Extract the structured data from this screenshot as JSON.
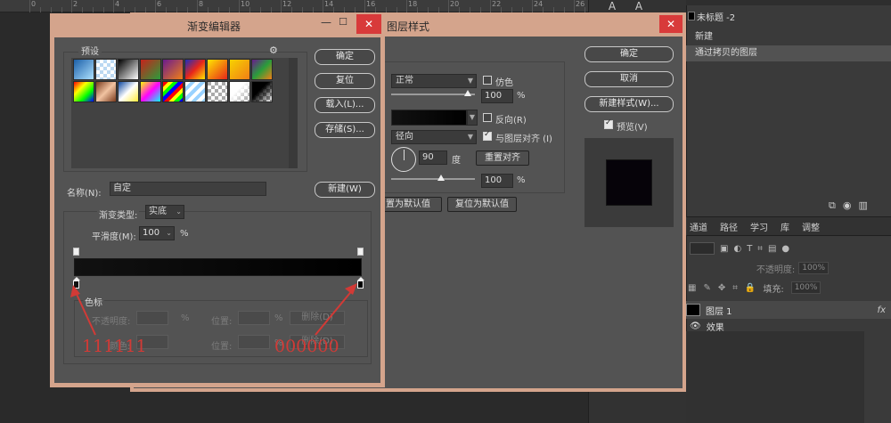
{
  "background_app": {
    "ruler_numbers": [
      "0",
      "2",
      "4",
      "6",
      "8",
      "10",
      "12",
      "14",
      "16",
      "18",
      "20",
      "22",
      "24",
      "26"
    ],
    "tools": [
      "A",
      "A"
    ],
    "history": {
      "items": [
        {
          "label": "未标题 -2"
        },
        {
          "label": "新建"
        },
        {
          "label": "通过拷贝的图层"
        }
      ]
    },
    "panel_tabs": [
      "通道",
      "路径",
      "学习",
      "库",
      "调整"
    ],
    "opacity_label": "不透明度:",
    "opacity_value": "100%",
    "fill_label": "填充:",
    "fill_value": "100%",
    "layer_name": "图层 1",
    "layer_fx": "fx",
    "effect_label": "效果"
  },
  "layer_style": {
    "title": "图层样式",
    "close_glyph": "✕",
    "blend_mode": "正常",
    "dither_label": "仿色",
    "opacity_value": "100",
    "opacity_unit": "%",
    "reverse_label": "反向(R)",
    "style_value": "径向",
    "align_label": "与图层对齐 (I)",
    "angle_value": "90",
    "angle_unit": "度",
    "reset_align_label": "重置对齐",
    "scale_value": "100",
    "scale_unit": "%",
    "set_default_label": "置为默认值",
    "reset_default_label": "复位为默认值",
    "ok_label": "确定",
    "cancel_label": "取消",
    "new_style_label": "新建样式(W)...",
    "preview_label": "预览(V)"
  },
  "gradient_editor": {
    "title": "渐变编辑器",
    "min_glyph": "—",
    "max_glyph": "☐",
    "close_glyph": "✕",
    "presets_label": "预设",
    "gear_glyph": "⚙",
    "presets": [
      "linear-gradient(135deg,#1b5fa8,#aee1ff)",
      "repeating-conic-gradient(#ffffff 0 25%,#bcd9f2 0 50%) 0 0/8px 8px",
      "linear-gradient(135deg,#000000,#ffffff)",
      "linear-gradient(135deg,#c7221b,#2a9d3b)",
      "linear-gradient(135deg,#6a1b8f,#f07f16)",
      "linear-gradient(135deg,#1a2fbf,#e8261a,#ffe600)",
      "linear-gradient(135deg,#ffe600,#e8261a)",
      "linear-gradient(135deg,#f7d200,#f07f16)",
      "linear-gradient(135deg,#6a1b8f,#2a9d3b,#f07f16)",
      "linear-gradient(135deg,#ff0000,#ffff00,#00ff00,#0000ff)",
      "linear-gradient(135deg,#7a3b1d,#f1c3a1,#7a3b1d)",
      "linear-gradient(135deg,#0d47a1,#ffffff,#ffeb3b)",
      "linear-gradient(135deg,#ffff00,#ff00ff,#00ffff)",
      "repeating-linear-gradient(135deg,#ff0000 0 4px,#ffff00 4px 8px,#00ff00 8px 12px,#0000ff 12px 16px)",
      "repeating-linear-gradient(135deg,#ffffff 0 4px,#9ad2ff 4px 8px)",
      "repeating-conic-gradient(#ffffff 0 25%,#aaaaaa 0 50%) 0 0/8px 8px",
      "linear-gradient(135deg,#ffffff 0 40%,transparent),repeating-conic-gradient(#ffffff 0 25%,#9a9a9a 0 50%) 0 0/8px 8px",
      "linear-gradient(135deg,#000000 0 40%,transparent),repeating-conic-gradient(#ffffff 0 25%,#9a9a9a 0 50%) 0 0/8px 8px"
    ],
    "ok_label": "确定",
    "reset_label": "复位",
    "load_label": "载入(L)...",
    "save_label": "存储(S)...",
    "name_label": "名称(N):",
    "name_value": "自定",
    "new_label": "新建(W)",
    "type_label": "渐变类型:",
    "type_value": "实底",
    "smooth_label": "平滑度(M):",
    "smooth_value": "100",
    "smooth_unit": "%",
    "gradient_stops": [
      {
        "color": "#111111",
        "position": 0
      },
      {
        "color": "#000000",
        "position": 100
      }
    ],
    "color_stops_label": "色标",
    "opacity_label": "不透明度:",
    "opacity_unit": "%",
    "location_label": "位置:",
    "location_unit": "%",
    "delete_label": "删除(D)",
    "color_label": "颜色:",
    "location2_label": "位置:",
    "location2_unit": "%",
    "delete2_label": "删除(D)"
  },
  "annotations": {
    "left_color": "111111",
    "right_color": "000000",
    "color": "#d23a36"
  }
}
